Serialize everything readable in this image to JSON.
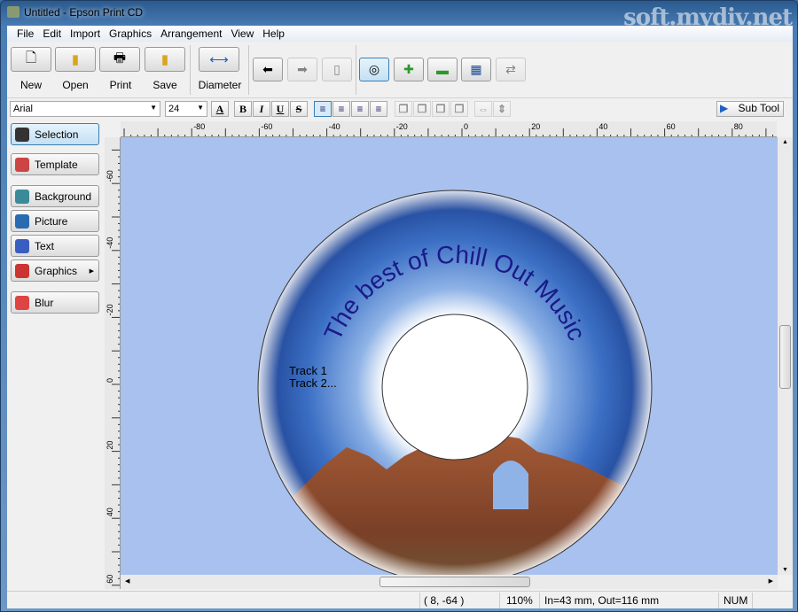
{
  "window": {
    "title": "Untitled - Epson Print CD",
    "watermark": "soft.mydiv.net"
  },
  "menu": [
    "File",
    "Edit",
    "Import",
    "Graphics",
    "Arrangement",
    "View",
    "Help"
  ],
  "toolbar": {
    "new": "New",
    "open": "Open",
    "print": "Print",
    "save": "Save",
    "diameter": "Diameter"
  },
  "format": {
    "font": "Arial",
    "size": "24",
    "subtool": "Sub Tool"
  },
  "sidebar": [
    {
      "label": "Selection",
      "color": "#333"
    },
    {
      "label": "Template",
      "color": "#c44"
    },
    {
      "label": "Background",
      "color": "#3a8a9a"
    },
    {
      "label": "Picture",
      "color": "#2a6ab0"
    },
    {
      "label": "Text",
      "color": "#3a5ec0"
    },
    {
      "label": "Graphics",
      "color": "#c33"
    },
    {
      "label": "Blur",
      "color": "#d44"
    }
  ],
  "ruler": {
    "h": [
      "-80",
      "-60",
      "-40",
      "-20",
      "0",
      "20",
      "40",
      "60",
      "80"
    ],
    "v": [
      "-60",
      "-40",
      "-20",
      "0",
      "20",
      "40",
      "60"
    ]
  },
  "disc": {
    "arc_text": "The best of Chill Out Music",
    "text_color": "#1a1a8a",
    "tracks": [
      "Track 1",
      "Track 2..."
    ]
  },
  "status": {
    "coords": "(   8, -64 )",
    "zoom": "110%",
    "diameter": "In=43 mm, Out=116 mm",
    "num": "NUM"
  }
}
